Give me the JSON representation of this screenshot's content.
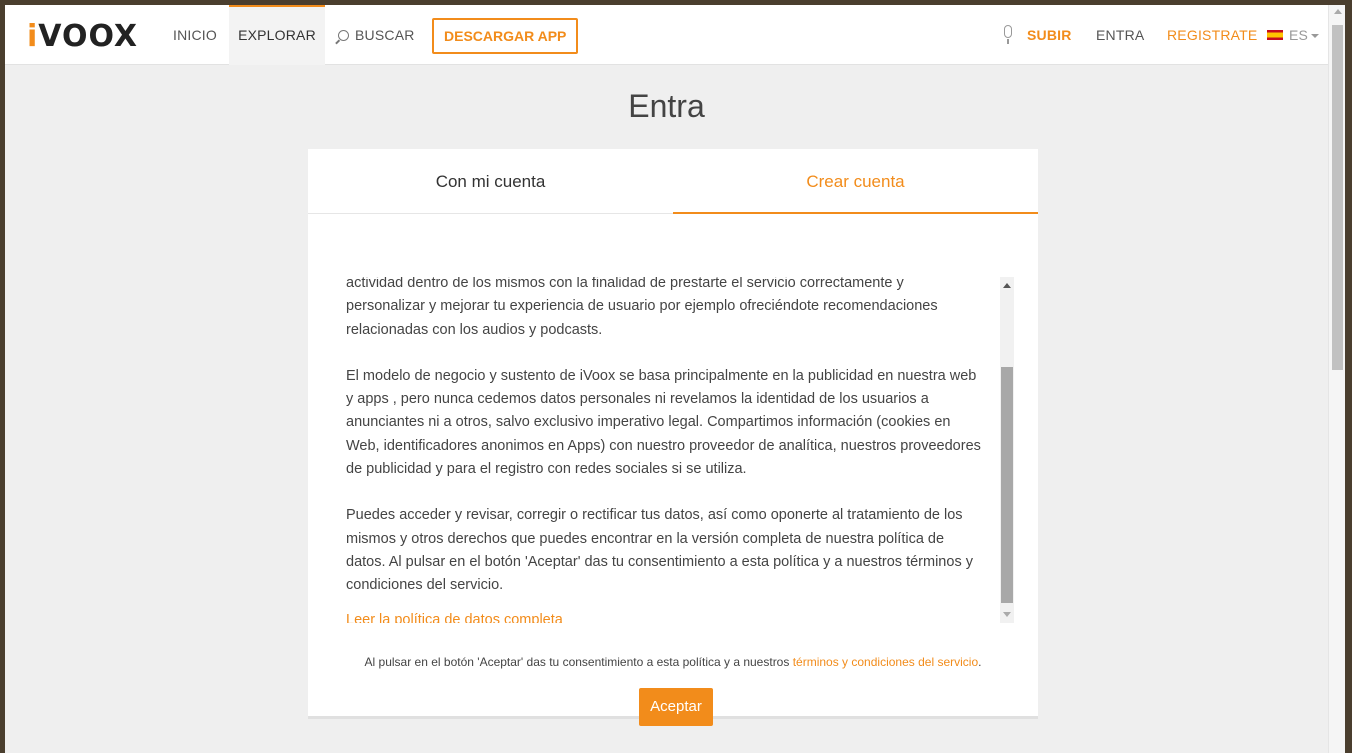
{
  "header": {
    "logo_i": "i",
    "logo_rest": "VOOX",
    "nav": {
      "inicio": "INICIO",
      "explorar": "EXPLORAR",
      "buscar": "BUSCAR",
      "descargar": "DESCARGAR APP",
      "subir": "SUBIR",
      "entra": "ENTRA",
      "registrate": "REGISTRATE",
      "lang": "ES"
    }
  },
  "page": {
    "title": "Entra"
  },
  "tabs": {
    "login": "Con mi cuenta",
    "create": "Crear cuenta",
    "active": "create"
  },
  "terms": {
    "paragraphs": [
      "actividad dentro de los mismos con la finalidad de prestarte el servicio correctamente y personalizar y mejorar tu experiencia de usuario por ejemplo ofreciéndote recomendaciones relacionadas con los audios y podcasts.",
      "El modelo de negocio y sustento de iVoox se basa principalmente en la publicidad en nuestra web y apps , pero nunca cedemos datos personales ni revelamos la identidad de los usuarios a anunciantes ni a otros, salvo exclusivo imperativo legal. Compartimos información (cookies en Web, identificadores anonimos en Apps) con nuestro proveedor de analítica, nuestros proveedores de publicidad y para el registro con redes sociales si se utiliza.",
      "Puedes acceder y revisar, corregir o rectificar tus datos, así como oponerte al tratamiento de los mismos y otros derechos que puedes encontrar en la versión completa de nuestra política de datos. Al pulsar en el botón 'Aceptar' das tu consentimiento a esta política y a nuestros términos y condiciones del servicio."
    ],
    "full_policy_link": "Leer la política de datos completa"
  },
  "consent": {
    "text": "Al pulsar en el botón 'Aceptar' das tu consentimiento a esta política y a nuestros ",
    "link": "términos y condiciones del servicio",
    "end": "."
  },
  "accept_button": "Aceptar",
  "colors": {
    "accent": "#f28c1b",
    "background": "#efefef"
  }
}
